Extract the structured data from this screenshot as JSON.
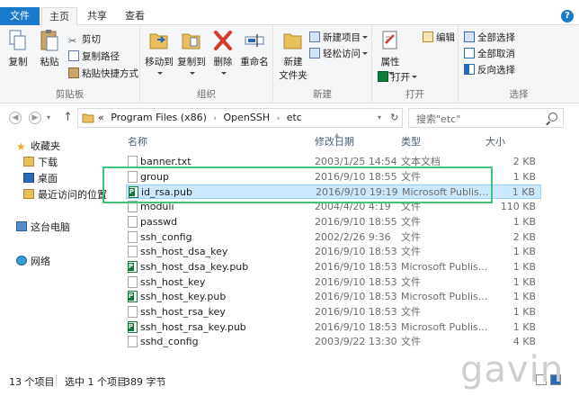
{
  "ribbon_tabs": [
    {
      "label": "文件"
    },
    {
      "label": "主页"
    },
    {
      "label": "共享"
    },
    {
      "label": "查看"
    }
  ],
  "help_label": "?",
  "clipboard": {
    "copy": "复制",
    "paste": "粘贴",
    "cut": "剪切",
    "copy_path": "复制路径",
    "paste_shortcut": "粘贴快捷方式",
    "label": "剪贴板"
  },
  "organize": {
    "move_to": "移动到",
    "copy_to": "复制到",
    "delete": "删除",
    "rename": "重命名",
    "label": "组织"
  },
  "new_group": {
    "new_folder_1": "新建",
    "new_folder_2": "文件夹",
    "new_item": "新建项目",
    "easy_access": "轻松访问",
    "label": "新建"
  },
  "open_group": {
    "properties": "属性",
    "open": "打开",
    "edit": "编辑",
    "label": "打开"
  },
  "select_group": {
    "select_all": "全部选择",
    "select_none": "全部取消",
    "invert": "反向选择",
    "label": "选择"
  },
  "address": {
    "prefix": "«",
    "crumbs": [
      "Program Files (x86)",
      "OpenSSH",
      "etc"
    ],
    "separator": "›"
  },
  "search": {
    "placeholder": "搜索\"etc\""
  },
  "nav_pane": {
    "favorites": "收藏夹",
    "downloads": "下载",
    "desktop": "桌面",
    "recent": "最近访问的位置",
    "this_pc": "这台电脑",
    "network": "网络"
  },
  "columns": {
    "name": "名称",
    "date": "修改日期",
    "type": "类型",
    "size": "大小"
  },
  "files": [
    {
      "name": "banner.txt",
      "date": "2003/1/25 14:54",
      "type": "文本文档",
      "size": "2 KB",
      "icon": "doc",
      "selected": false
    },
    {
      "name": "group",
      "date": "2016/9/10 18:55",
      "type": "文件",
      "size": "1 KB",
      "icon": "doc",
      "selected": false
    },
    {
      "name": "id_rsa.pub",
      "date": "2016/9/10 19:19",
      "type": "Microsoft Publis...",
      "size": "1 KB",
      "icon": "pub",
      "selected": true
    },
    {
      "name": "moduli",
      "date": "2004/4/20 4:19",
      "type": "文件",
      "size": "110 KB",
      "icon": "doc",
      "selected": false
    },
    {
      "name": "passwd",
      "date": "2016/9/10 18:55",
      "type": "文件",
      "size": "1 KB",
      "icon": "doc",
      "selected": false
    },
    {
      "name": "ssh_config",
      "date": "2002/2/26 9:36",
      "type": "文件",
      "size": "2 KB",
      "icon": "doc",
      "selected": false
    },
    {
      "name": "ssh_host_dsa_key",
      "date": "2016/9/10 18:53",
      "type": "文件",
      "size": "1 KB",
      "icon": "doc",
      "selected": false
    },
    {
      "name": "ssh_host_dsa_key.pub",
      "date": "2016/9/10 18:53",
      "type": "Microsoft Publis...",
      "size": "1 KB",
      "icon": "pub",
      "selected": false
    },
    {
      "name": "ssh_host_key",
      "date": "2016/9/10 18:53",
      "type": "文件",
      "size": "1 KB",
      "icon": "doc",
      "selected": false
    },
    {
      "name": "ssh_host_key.pub",
      "date": "2016/9/10 18:53",
      "type": "Microsoft Publis...",
      "size": "1 KB",
      "icon": "pub",
      "selected": false
    },
    {
      "name": "ssh_host_rsa_key",
      "date": "2016/9/10 18:53",
      "type": "文件",
      "size": "1 KB",
      "icon": "doc",
      "selected": false
    },
    {
      "name": "ssh_host_rsa_key.pub",
      "date": "2016/9/10 18:53",
      "type": "Microsoft Publis...",
      "size": "1 KB",
      "icon": "pub",
      "selected": false
    },
    {
      "name": "sshd_config",
      "date": "2003/9/22 13:30",
      "type": "文件",
      "size": "4 KB",
      "icon": "doc",
      "selected": false
    }
  ],
  "status": {
    "count": "13 个项目",
    "selected": "选中 1 个项目",
    "size": "389 字节"
  },
  "watermark": "gavin",
  "colors": {
    "accent": "#1979ca",
    "selection_bg": "#cce8ff",
    "highlight_box": "#3ec47b"
  }
}
